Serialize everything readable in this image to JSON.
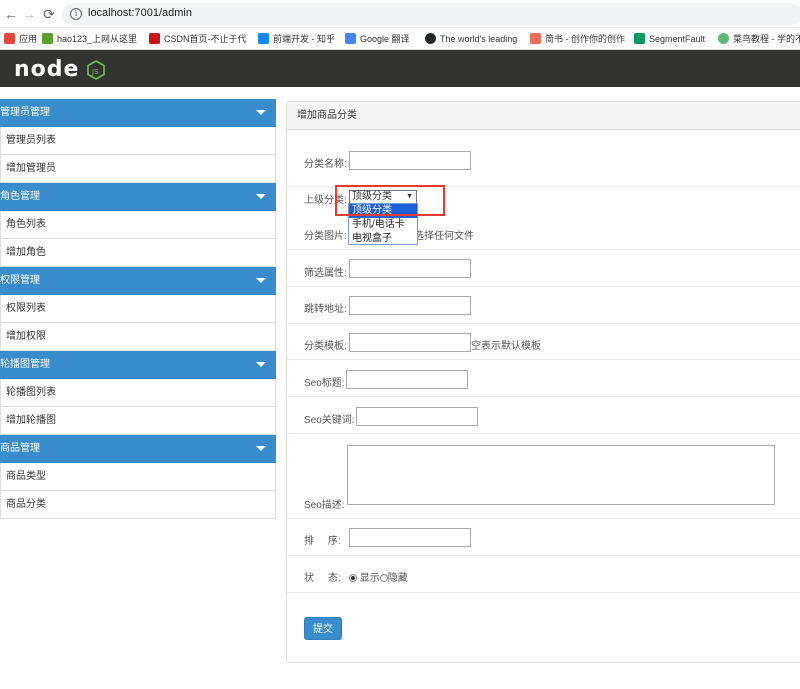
{
  "browser": {
    "url": "localhost:7001/admin",
    "bookmarks": [
      {
        "label": "应用",
        "color": "#e8453c"
      },
      {
        "label": "hao123_上网从这里",
        "color": "#5aa02c"
      },
      {
        "label": "CSDN首页-不止于代",
        "color": "#c8161d"
      },
      {
        "label": "前端开发 - 知乎",
        "color": "#0f88eb"
      },
      {
        "label": "Google 翻译",
        "color": "#4285f4"
      },
      {
        "label": "The world's leading",
        "color": "#24292e"
      },
      {
        "label": "简书 - 创作你的创作",
        "color": "#ea6f5a"
      },
      {
        "label": "SegmentFault",
        "color": "#009a61"
      },
      {
        "label": "菜鸟教程 - 学的不",
        "color": "#5fb878"
      }
    ]
  },
  "sidebar": {
    "groups": [
      {
        "title": "管理员管理",
        "items": [
          "管理员列表",
          "增加管理员"
        ]
      },
      {
        "title": "角色管理",
        "items": [
          "角色列表",
          "增加角色"
        ]
      },
      {
        "title": "权限管理",
        "items": [
          "权限列表",
          "增加权限"
        ]
      },
      {
        "title": "轮播图管理",
        "items": [
          "轮播图列表",
          "增加轮播图"
        ]
      },
      {
        "title": "商品管理",
        "items": [
          "商品类型",
          "商品分类"
        ]
      }
    ]
  },
  "panel": {
    "title": "增加商品分类",
    "fields": {
      "name_label": "分类名称:",
      "parent_label": "上级分类:",
      "parent_selected": "顶级分类",
      "parent_options": [
        "顶级分类",
        "手机/电话卡",
        "电视盒子"
      ],
      "image_label": "分类图片:",
      "image_hint": "选择任何文件",
      "filter_label": "筛选属性:",
      "link_label": "跳转地址:",
      "template_label": "分类模板:",
      "template_hint": "空表示默认模板",
      "seo_title_label": "Seo标题:",
      "seo_keywords_label": "Seo关键词:",
      "seo_desc_label": "Seo描述:",
      "sort_label": "排     序:",
      "status_label": "状     态:",
      "status_show": "显示",
      "status_hide": "隐藏"
    },
    "submit_label": "提交"
  }
}
